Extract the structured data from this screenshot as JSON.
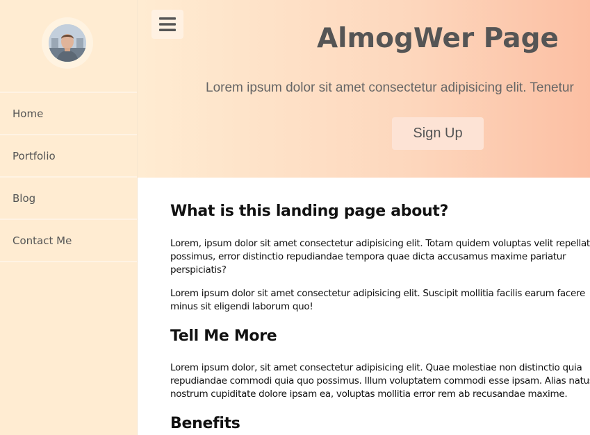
{
  "sidebar": {
    "nav_items": [
      {
        "label": "Home"
      },
      {
        "label": "Portfolio"
      },
      {
        "label": "Blog"
      },
      {
        "label": "Contact Me"
      }
    ]
  },
  "header": {
    "title": "AlmogWer Page",
    "subtitle": "Lorem ipsum dolor sit amet consectetur adipisicing elit. Tenetur",
    "signup_label": "Sign Up"
  },
  "main": {
    "sections": [
      {
        "heading": "What is this landing page about?",
        "paragraphs": [
          "Lorem, ipsum dolor sit amet consectetur adipisicing elit. Totam quidem voluptas velit repellat qui possimus, error distinctio repudiandae tempora quae dicta accusamus maxime pariatur perspiciatis?",
          "Lorem ipsum dolor sit amet consectetur adipisicing elit. Suscipit mollitia facilis earum facere minus sit eligendi laborum quo!"
        ]
      },
      {
        "heading": "Tell Me More",
        "paragraphs": [
          "Lorem ipsum dolor, sit amet consectetur adipisicing elit. Quae molestiae non distinctio quia repudiandae commodi quia quo possimus. Illum voluptatem commodi esse ipsam. Alias natus nostrum cupiditate dolore ipsam ea, voluptas mollitia error rem ab recusandae maxime."
        ]
      },
      {
        "heading": "Benefits",
        "paragraphs": []
      }
    ]
  },
  "colors": {
    "sidebar_bg": "#ffecd2",
    "header_gradient_start": "#ffecd2",
    "header_gradient_end": "#fcbfa3",
    "text_muted": "#555555"
  },
  "icons": {
    "menu": "hamburger-menu-icon",
    "avatar": "profile-photo"
  }
}
